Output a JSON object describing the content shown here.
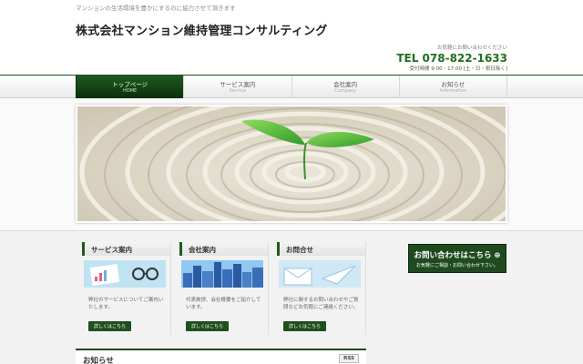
{
  "header": {
    "tagline": "マンションの生活環境を豊かにするのに協力させて頂きます",
    "title": "株式会社マンション維持管理コンサルティング",
    "contact_invite": "お気軽にお問い合わせください",
    "tel": "TEL 078-822-1633",
    "hours": "受付時間 9:00 - 17:00 [土・日・祝日除く]"
  },
  "nav": [
    {
      "label": "トップページ",
      "sub": "HOME"
    },
    {
      "label": "サービス案内",
      "sub": "Service"
    },
    {
      "label": "会社案内",
      "sub": "Company"
    },
    {
      "label": "お知らせ",
      "sub": "Information"
    }
  ],
  "boxes": [
    {
      "title": "サービス案内",
      "text": "弊社のサービスについてご案内いたします。",
      "button": "詳しくはこちら"
    },
    {
      "title": "会社案内",
      "text": "代表挨拶、会社概要をご紹介しています。",
      "button": "詳しくはこちら"
    },
    {
      "title": "お問合せ",
      "text": "弊社に関するお問い合わせやご質問などお気軽にご連絡ください。",
      "button": "詳しくはこちら"
    }
  ],
  "cta": {
    "main": "お問い合わせはこちら ⊕",
    "sub": "お気軽にご相談・お問い合わせ下さい。"
  },
  "news": {
    "title": "お知らせ",
    "rss": "RSS"
  },
  "colors": {
    "brand_green": "#1f4a1f",
    "tel_green": "#1f6e1f"
  }
}
